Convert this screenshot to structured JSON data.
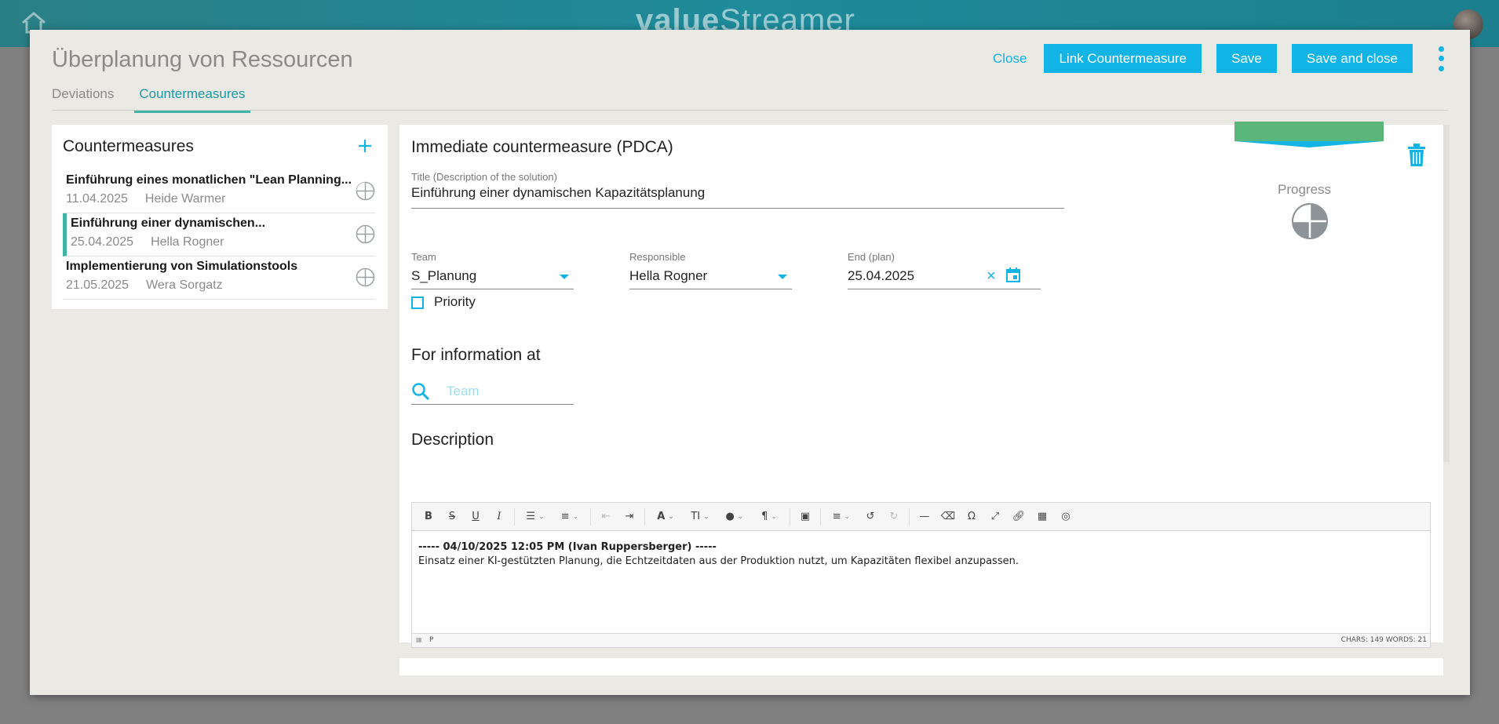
{
  "app": {
    "brand_bold": "value",
    "brand_light": "Streamer"
  },
  "modal": {
    "title": "Überplanung von Ressourcen",
    "tabs": [
      {
        "label": "Deviations",
        "active": false
      },
      {
        "label": "Countermeasures",
        "active": true
      }
    ],
    "actions": {
      "close": "Close",
      "link": "Link Countermeasure",
      "save": "Save",
      "save_close": "Save and close"
    }
  },
  "left": {
    "title": "Countermeasures",
    "items": [
      {
        "title": "Einführung eines monatlichen \"Lean Planning...",
        "date": "11.04.2025",
        "person": "Heide Warmer",
        "selected": false
      },
      {
        "title": "Einführung einer dynamischen...",
        "date": "25.04.2025",
        "person": "Hella Rogner",
        "selected": true
      },
      {
        "title": "Implementierung von Simulationstools",
        "date": "21.05.2025",
        "person": "Wera Sorgatz",
        "selected": false
      }
    ]
  },
  "detail": {
    "heading": "Immediate countermeasure (PDCA)",
    "status_color": "#5bb67b",
    "progress_label": "Progress",
    "title_label": "Title (Description of the solution)",
    "title_value": "Einführung einer dynamischen Kapazitätsplanung",
    "team_label": "Team",
    "team_value": "S_Planung",
    "responsible_label": "Responsible",
    "responsible_value": "Hella Rogner",
    "end_label": "End (plan)",
    "end_value": "25.04.2025",
    "priority_label": "Priority",
    "info_heading": "For information at",
    "info_placeholder": "Team",
    "description_heading": "Description",
    "editor": {
      "stamp": "----- 04/10/2025 12:05 PM (Ivan Ruppersberger) -----",
      "text": "Einsatz einer KI-gestützten Planung, die Echtzeitdaten aus der Produktion nutzt, um Kapazitäten flexibel anzupassen.",
      "path": "P",
      "counts": "CHARS: 149   WORDS: 21"
    }
  },
  "colors": {
    "accent": "#12b4e6",
    "teal": "#3fb5a8"
  }
}
